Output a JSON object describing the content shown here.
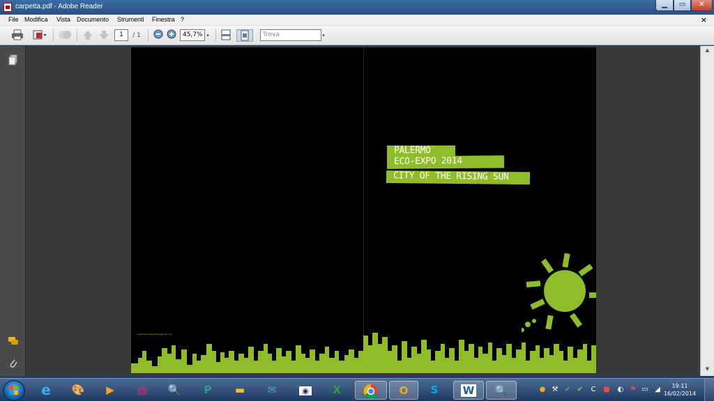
{
  "window": {
    "title": "carpetta.pdf - Adobe Reader",
    "min": "▁",
    "max": "▭",
    "close": "✕"
  },
  "menubar": {
    "items": [
      "File",
      "Modifica",
      "Vista",
      "Documento",
      "Strumenti",
      "Finestra",
      "?"
    ],
    "close": "×"
  },
  "toolbar": {
    "page_current": "1",
    "page_total": "/ 1",
    "zoom": "45,7%",
    "search_placeholder": "Trova"
  },
  "document": {
    "banner_lines": [
      "PALERMO",
      "ECO-EXPO 2014",
      "CITY OF THE RISING SUN"
    ],
    "accent_color": "#8fbd2a",
    "background": "#000000",
    "hashtag": "palermoecoexpo2014@gmail.com"
  },
  "taskbar": {
    "clock_time": "19:11",
    "clock_date": "16/02/2014",
    "apps": [
      "internet-explorer-icon",
      "paint-icon",
      "media-player-icon",
      "winrar-icon",
      "magnifier-icon",
      "publisher-icon",
      "file-explorer-icon",
      "thunderbird-icon",
      "snipping-icon",
      "excel-icon",
      "chrome-icon",
      "outlook-icon",
      "skype-icon",
      "word-icon",
      "search-app-icon"
    ]
  }
}
